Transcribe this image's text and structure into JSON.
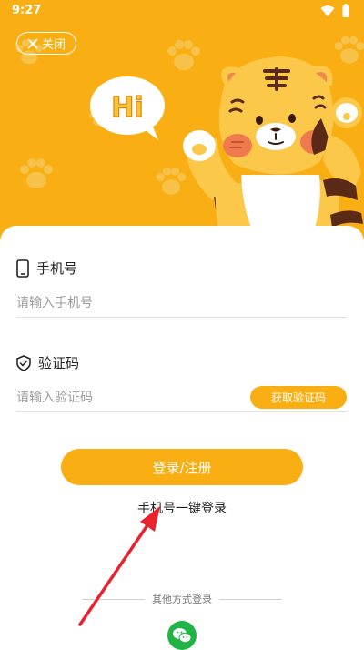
{
  "status_bar": {
    "time": "9:27",
    "wifi_icon": "wifi-icon",
    "battery_icon": "battery-icon"
  },
  "header": {
    "close_label": "关闭",
    "close_icon": "close-icon",
    "bubble_text": "Hi",
    "bg_color": "#F9AE14"
  },
  "form": {
    "phone": {
      "label": "手机号",
      "placeholder": "请输入手机号",
      "icon": "phone-icon"
    },
    "code": {
      "label": "验证码",
      "placeholder": "请输入验证码",
      "icon": "shield-check-icon",
      "get_code_label": "获取验证码"
    },
    "submit_label": "登录/注册",
    "one_key_label": "手机号一键登录"
  },
  "other_login": {
    "label": "其他方式登录",
    "wechat_icon": "wechat-icon"
  },
  "colors": {
    "accent": "#F9AE14",
    "wechat": "#20B445",
    "annotation": "#E8232F"
  }
}
